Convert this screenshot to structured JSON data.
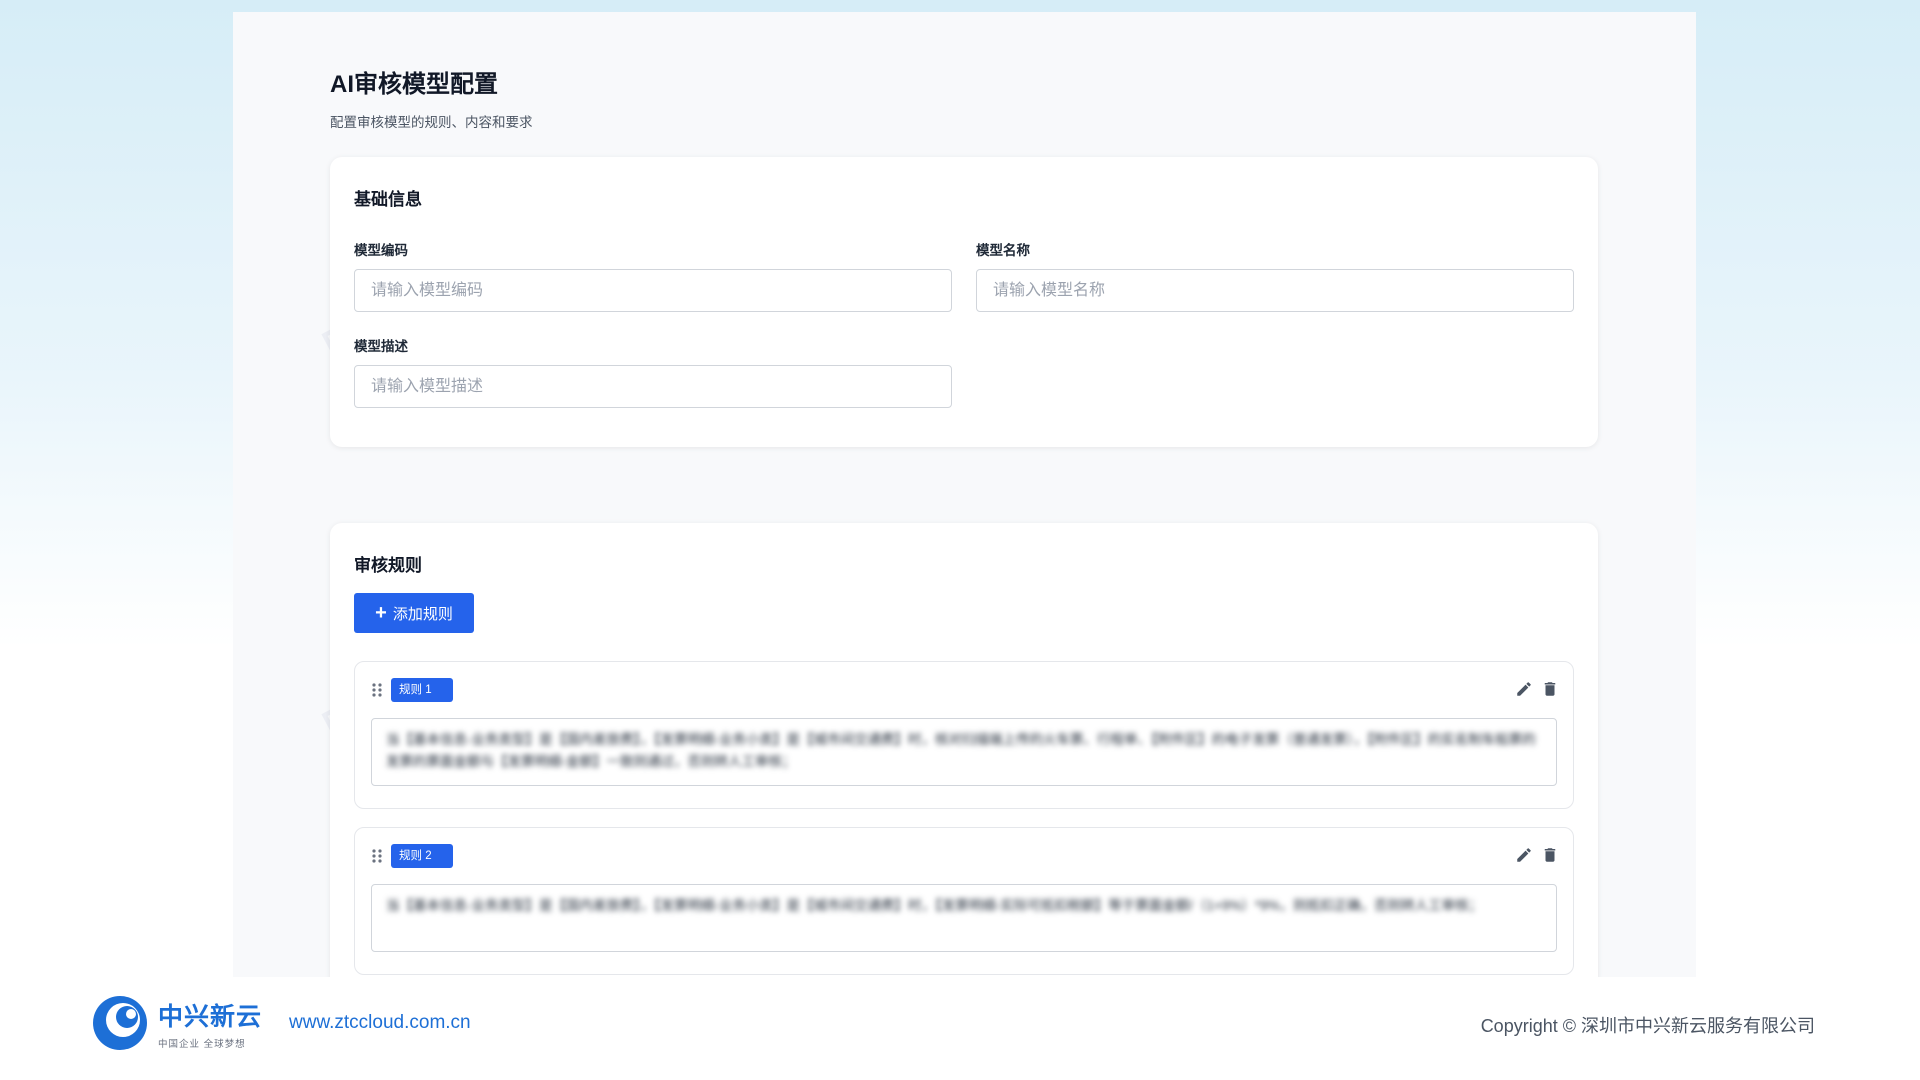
{
  "page": {
    "title": "AI审核模型配置",
    "subtitle": "配置审核模型的规则、内容和要求"
  },
  "basic_info": {
    "section_title": "基础信息",
    "fields": [
      {
        "label": "模型编码",
        "placeholder": "请输入模型编码",
        "value": ""
      },
      {
        "label": "模型名称",
        "placeholder": "请输入模型名称",
        "value": ""
      },
      {
        "label": "模型描述",
        "placeholder": "请输入模型描述",
        "value": ""
      }
    ]
  },
  "rules_section": {
    "section_title": "审核规则",
    "add_button_label": "添加规则",
    "add_button_icon": "plus-icon",
    "rules": [
      {
        "badge": "规则 1",
        "text": "当【基本信息-业务类型】是【国内差旅费】，【发票明细-业务小类】是【城市间交通费】时，核对扫描端上传的火车票、行程单、【附件区】的电子发票（普通发票），【附件区】的实名制车船票的发票的票面金额与【发票明细-金额】一致则通过，否则转人工审核；"
      },
      {
        "badge": "规则 2",
        "text": "当【基本信息-业务类型】是【国内差旅费】，【发票明细-业务小类】是【城市间交通费】时，【发票明细-实际可抵扣税额】等于票面金额/（1+9%）*9%，则抵扣正确，否则转人工审核；"
      }
    ],
    "rule_icons": [
      "drag-handle-icon",
      "edit-pencil-icon",
      "trash-icon"
    ]
  },
  "watermark": {
    "text": "中兴新云",
    "slogan": "中国企业 全球梦想"
  },
  "footer": {
    "logo_text": "中兴新云",
    "logo_slogan": "中国企业  全球梦想",
    "url": "www.ztccloud.com.cn",
    "copyright": "Copyright © 深圳市中兴新云服务有限公司"
  },
  "colors": {
    "primary": "#2563eb",
    "brand_blue": "#1d6fd6",
    "panel_bg": "#f8f9fb"
  }
}
